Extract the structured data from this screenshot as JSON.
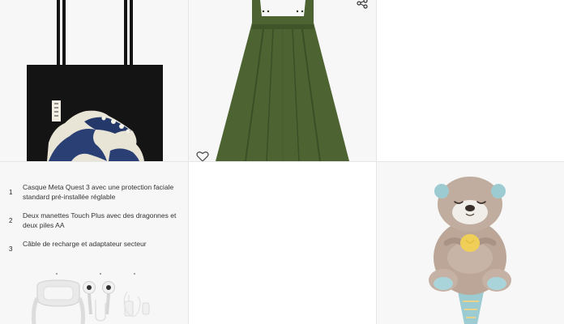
{
  "products": {
    "quest_contents": [
      {
        "number": "1",
        "text": "Casque Meta Quest 3 avec une protection faciale standard pré-installée réglable"
      },
      {
        "number": "2",
        "text": "Deux manettes Touch Plus avec des dragonnes et deux piles AA"
      },
      {
        "number": "3",
        "text": "Câble de recharge et adaptateur secteur"
      }
    ]
  },
  "icons": {
    "share": "share-icon",
    "favorite": "heart-icon"
  },
  "colors": {
    "tote_bag": "#141414",
    "dress": "#4d6432",
    "otter": "#bba698",
    "divider": "#e6e6e6"
  }
}
